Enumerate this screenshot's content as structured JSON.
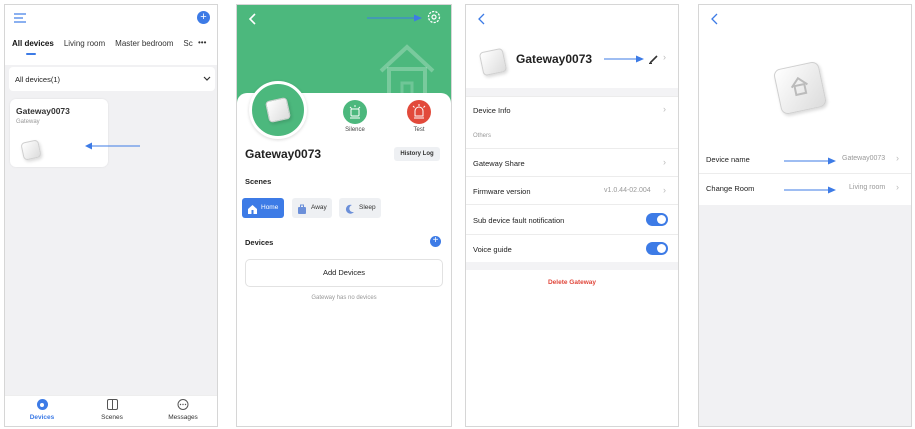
{
  "screen1": {
    "tabs": [
      "All devices",
      "Living room",
      "Master bedroom",
      "Sc"
    ],
    "more": "•••",
    "filter_label": "All devices(1)",
    "device_name": "Gateway0073",
    "device_type": "Gateway",
    "nav": {
      "devices": "Devices",
      "scenes": "Scenes",
      "messages": "Messages"
    }
  },
  "screen2": {
    "silence": "Silence",
    "test": "Test",
    "device_name": "Gateway0073",
    "history_log": "History Log",
    "scenes_title": "Scenes",
    "scenes": {
      "home": "Home",
      "away": "Away",
      "sleep": "Sleep"
    },
    "devices_title": "Devices",
    "add_devices": "Add Devices",
    "empty_note": "Gateway has no devices"
  },
  "screen3": {
    "device_name": "Gateway0073",
    "device_info": "Device Info",
    "others": "Others",
    "gateway_share": "Gateway Share",
    "firmware_label": "Firmware version",
    "firmware_value": "v1.0.44-02.004",
    "sub_fault": "Sub device fault notification",
    "voice_guide": "Voice guide",
    "delete": "Delete Gateway"
  },
  "screen4": {
    "device_name_label": "Device name",
    "device_name_value": "Gateway0073",
    "change_room_label": "Change Room",
    "change_room_value": "Living room"
  },
  "colors": {
    "accent": "#3d7be6",
    "green": "#4cb87d",
    "red": "#e24a3b",
    "delete": "#e0463a"
  }
}
